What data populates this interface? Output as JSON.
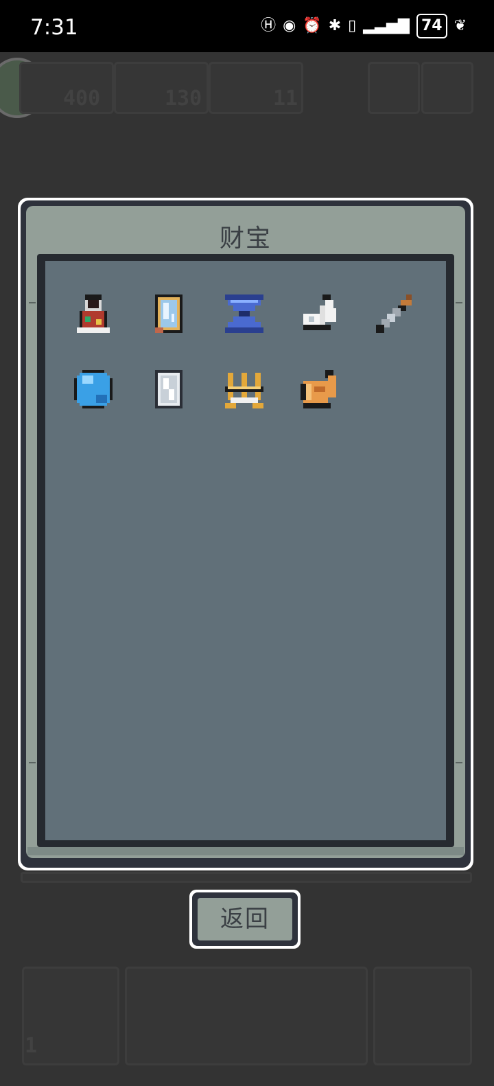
{
  "status_bar": {
    "time": "7:31",
    "battery": "74",
    "icons": [
      "hd-call-icon",
      "eye-icon",
      "alarm-icon",
      "bluetooth-icon",
      "phone-battery-icon",
      "signal-icon",
      "battery-icon",
      "leaf-icon"
    ]
  },
  "background_hud": {
    "counters": [
      "400",
      "130",
      "11"
    ],
    "bottom_counter": "1"
  },
  "dialog": {
    "title": "财宝",
    "items": [
      {
        "name": "red-potion-flask-icon"
      },
      {
        "name": "magic-mirror-icon"
      },
      {
        "name": "blue-hourglass-icon"
      },
      {
        "name": "white-wing-icon"
      },
      {
        "name": "dagger-icon"
      },
      {
        "name": "blue-orb-icon"
      },
      {
        "name": "silver-shield-stone-icon"
      },
      {
        "name": "golden-crown-icon"
      },
      {
        "name": "golden-horn-icon"
      }
    ]
  },
  "back_button": {
    "label": "返回"
  },
  "colors": {
    "background": "#333333",
    "dialog_fill": "#939f98",
    "panel_fill": "#617079",
    "frame": "#2e323c"
  }
}
